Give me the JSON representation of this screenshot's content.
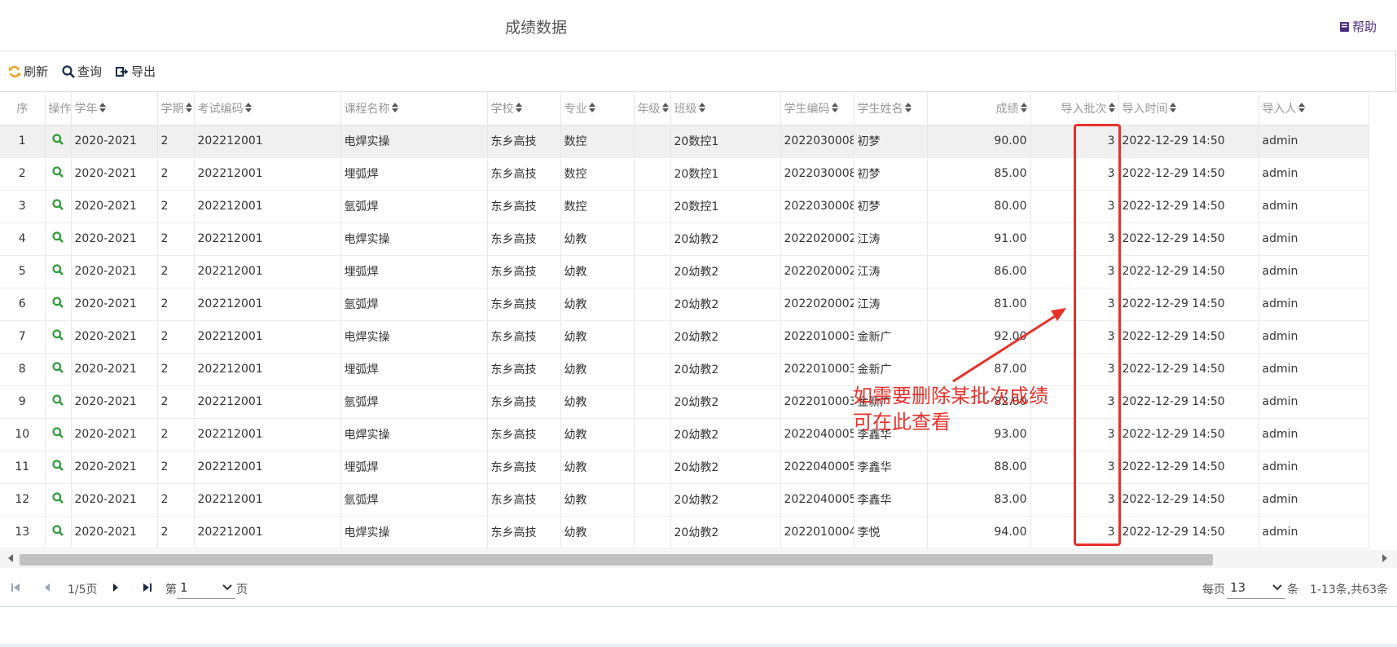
{
  "header": {
    "title": "成绩数据",
    "help_label": "帮助",
    "help_icon": "book-icon",
    "help_color": "#4b2e83"
  },
  "toolbar": {
    "refresh_label": "刷新",
    "refresh_icon": "refresh-icon",
    "query_label": "查询",
    "query_icon": "search-icon",
    "export_label": "导出",
    "export_icon": "export-icon"
  },
  "table": {
    "columns": [
      "序",
      "操作",
      "学年",
      "学期",
      "考试编码",
      "课程名称",
      "学校",
      "专业",
      "年级",
      "班级",
      "学生编码",
      "学生姓名",
      "成绩",
      "导入批次",
      "导入时间",
      "导入人"
    ],
    "rows": [
      {
        "no": "1",
        "year": "2020-2021",
        "term": "2",
        "exam_code": "202212001",
        "course": "电焊实操",
        "school": "东乡高技",
        "major": "数控",
        "grade": "",
        "class": "20数控1",
        "student_code": "2022030008",
        "student_name": "初梦",
        "score": "90.00",
        "batch": "3",
        "import_time": "2022-12-29 14:50",
        "importer": "admin"
      },
      {
        "no": "2",
        "year": "2020-2021",
        "term": "2",
        "exam_code": "202212001",
        "course": "埋弧焊",
        "school": "东乡高技",
        "major": "数控",
        "grade": "",
        "class": "20数控1",
        "student_code": "2022030008",
        "student_name": "初梦",
        "score": "85.00",
        "batch": "3",
        "import_time": "2022-12-29 14:50",
        "importer": "admin"
      },
      {
        "no": "3",
        "year": "2020-2021",
        "term": "2",
        "exam_code": "202212001",
        "course": "氩弧焊",
        "school": "东乡高技",
        "major": "数控",
        "grade": "",
        "class": "20数控1",
        "student_code": "2022030008",
        "student_name": "初梦",
        "score": "80.00",
        "batch": "3",
        "import_time": "2022-12-29 14:50",
        "importer": "admin"
      },
      {
        "no": "4",
        "year": "2020-2021",
        "term": "2",
        "exam_code": "202212001",
        "course": "电焊实操",
        "school": "东乡高技",
        "major": "幼教",
        "grade": "",
        "class": "20幼教2",
        "student_code": "2022020002",
        "student_name": "江涛",
        "score": "91.00",
        "batch": "3",
        "import_time": "2022-12-29 14:50",
        "importer": "admin"
      },
      {
        "no": "5",
        "year": "2020-2021",
        "term": "2",
        "exam_code": "202212001",
        "course": "埋弧焊",
        "school": "东乡高技",
        "major": "幼教",
        "grade": "",
        "class": "20幼教2",
        "student_code": "2022020002",
        "student_name": "江涛",
        "score": "86.00",
        "batch": "3",
        "import_time": "2022-12-29 14:50",
        "importer": "admin"
      },
      {
        "no": "6",
        "year": "2020-2021",
        "term": "2",
        "exam_code": "202212001",
        "course": "氩弧焊",
        "school": "东乡高技",
        "major": "幼教",
        "grade": "",
        "class": "20幼教2",
        "student_code": "2022020002",
        "student_name": "江涛",
        "score": "81.00",
        "batch": "3",
        "import_time": "2022-12-29 14:50",
        "importer": "admin"
      },
      {
        "no": "7",
        "year": "2020-2021",
        "term": "2",
        "exam_code": "202212001",
        "course": "电焊实操",
        "school": "东乡高技",
        "major": "幼教",
        "grade": "",
        "class": "20幼教2",
        "student_code": "2022010003",
        "student_name": "金新广",
        "score": "92.00",
        "batch": "3",
        "import_time": "2022-12-29 14:50",
        "importer": "admin"
      },
      {
        "no": "8",
        "year": "2020-2021",
        "term": "2",
        "exam_code": "202212001",
        "course": "埋弧焊",
        "school": "东乡高技",
        "major": "幼教",
        "grade": "",
        "class": "20幼教2",
        "student_code": "2022010003",
        "student_name": "金新广",
        "score": "87.00",
        "batch": "3",
        "import_time": "2022-12-29 14:50",
        "importer": "admin"
      },
      {
        "no": "9",
        "year": "2020-2021",
        "term": "2",
        "exam_code": "202212001",
        "course": "氩弧焊",
        "school": "东乡高技",
        "major": "幼教",
        "grade": "",
        "class": "20幼教2",
        "student_code": "2022010003",
        "student_name": "金新广",
        "score": "82.00",
        "batch": "3",
        "import_time": "2022-12-29 14:50",
        "importer": "admin"
      },
      {
        "no": "10",
        "year": "2020-2021",
        "term": "2",
        "exam_code": "202212001",
        "course": "电焊实操",
        "school": "东乡高技",
        "major": "幼教",
        "grade": "",
        "class": "20幼教2",
        "student_code": "2022040005",
        "student_name": "李鑫华",
        "score": "93.00",
        "batch": "3",
        "import_time": "2022-12-29 14:50",
        "importer": "admin"
      },
      {
        "no": "11",
        "year": "2020-2021",
        "term": "2",
        "exam_code": "202212001",
        "course": "埋弧焊",
        "school": "东乡高技",
        "major": "幼教",
        "grade": "",
        "class": "20幼教2",
        "student_code": "2022040005",
        "student_name": "李鑫华",
        "score": "88.00",
        "batch": "3",
        "import_time": "2022-12-29 14:50",
        "importer": "admin"
      },
      {
        "no": "12",
        "year": "2020-2021",
        "term": "2",
        "exam_code": "202212001",
        "course": "氩弧焊",
        "school": "东乡高技",
        "major": "幼教",
        "grade": "",
        "class": "20幼教2",
        "student_code": "2022040005",
        "student_name": "李鑫华",
        "score": "83.00",
        "batch": "3",
        "import_time": "2022-12-29 14:50",
        "importer": "admin"
      },
      {
        "no": "13",
        "year": "2020-2021",
        "term": "2",
        "exam_code": "202212001",
        "course": "电焊实操",
        "school": "东乡高技",
        "major": "幼教",
        "grade": "",
        "class": "20幼教2",
        "student_code": "2022010004",
        "student_name": "李悦",
        "score": "94.00",
        "batch": "3",
        "import_time": "2022-12-29 14:50",
        "importer": "admin"
      }
    ],
    "selected_row": "1",
    "row_action_icon": "search-icon",
    "row_action_color": "#2e9a3a"
  },
  "pager": {
    "page_info": "1/5页",
    "page_prefix": "第",
    "page_value": "1",
    "page_suffix": "页",
    "per_page_prefix": "每页",
    "per_page_value": "13",
    "per_page_suffix": "条",
    "summary": "1-13条,共63条"
  },
  "annotation": {
    "text": "如需要删除某批次成绩\n可在此查看",
    "color": "#e8302a"
  }
}
